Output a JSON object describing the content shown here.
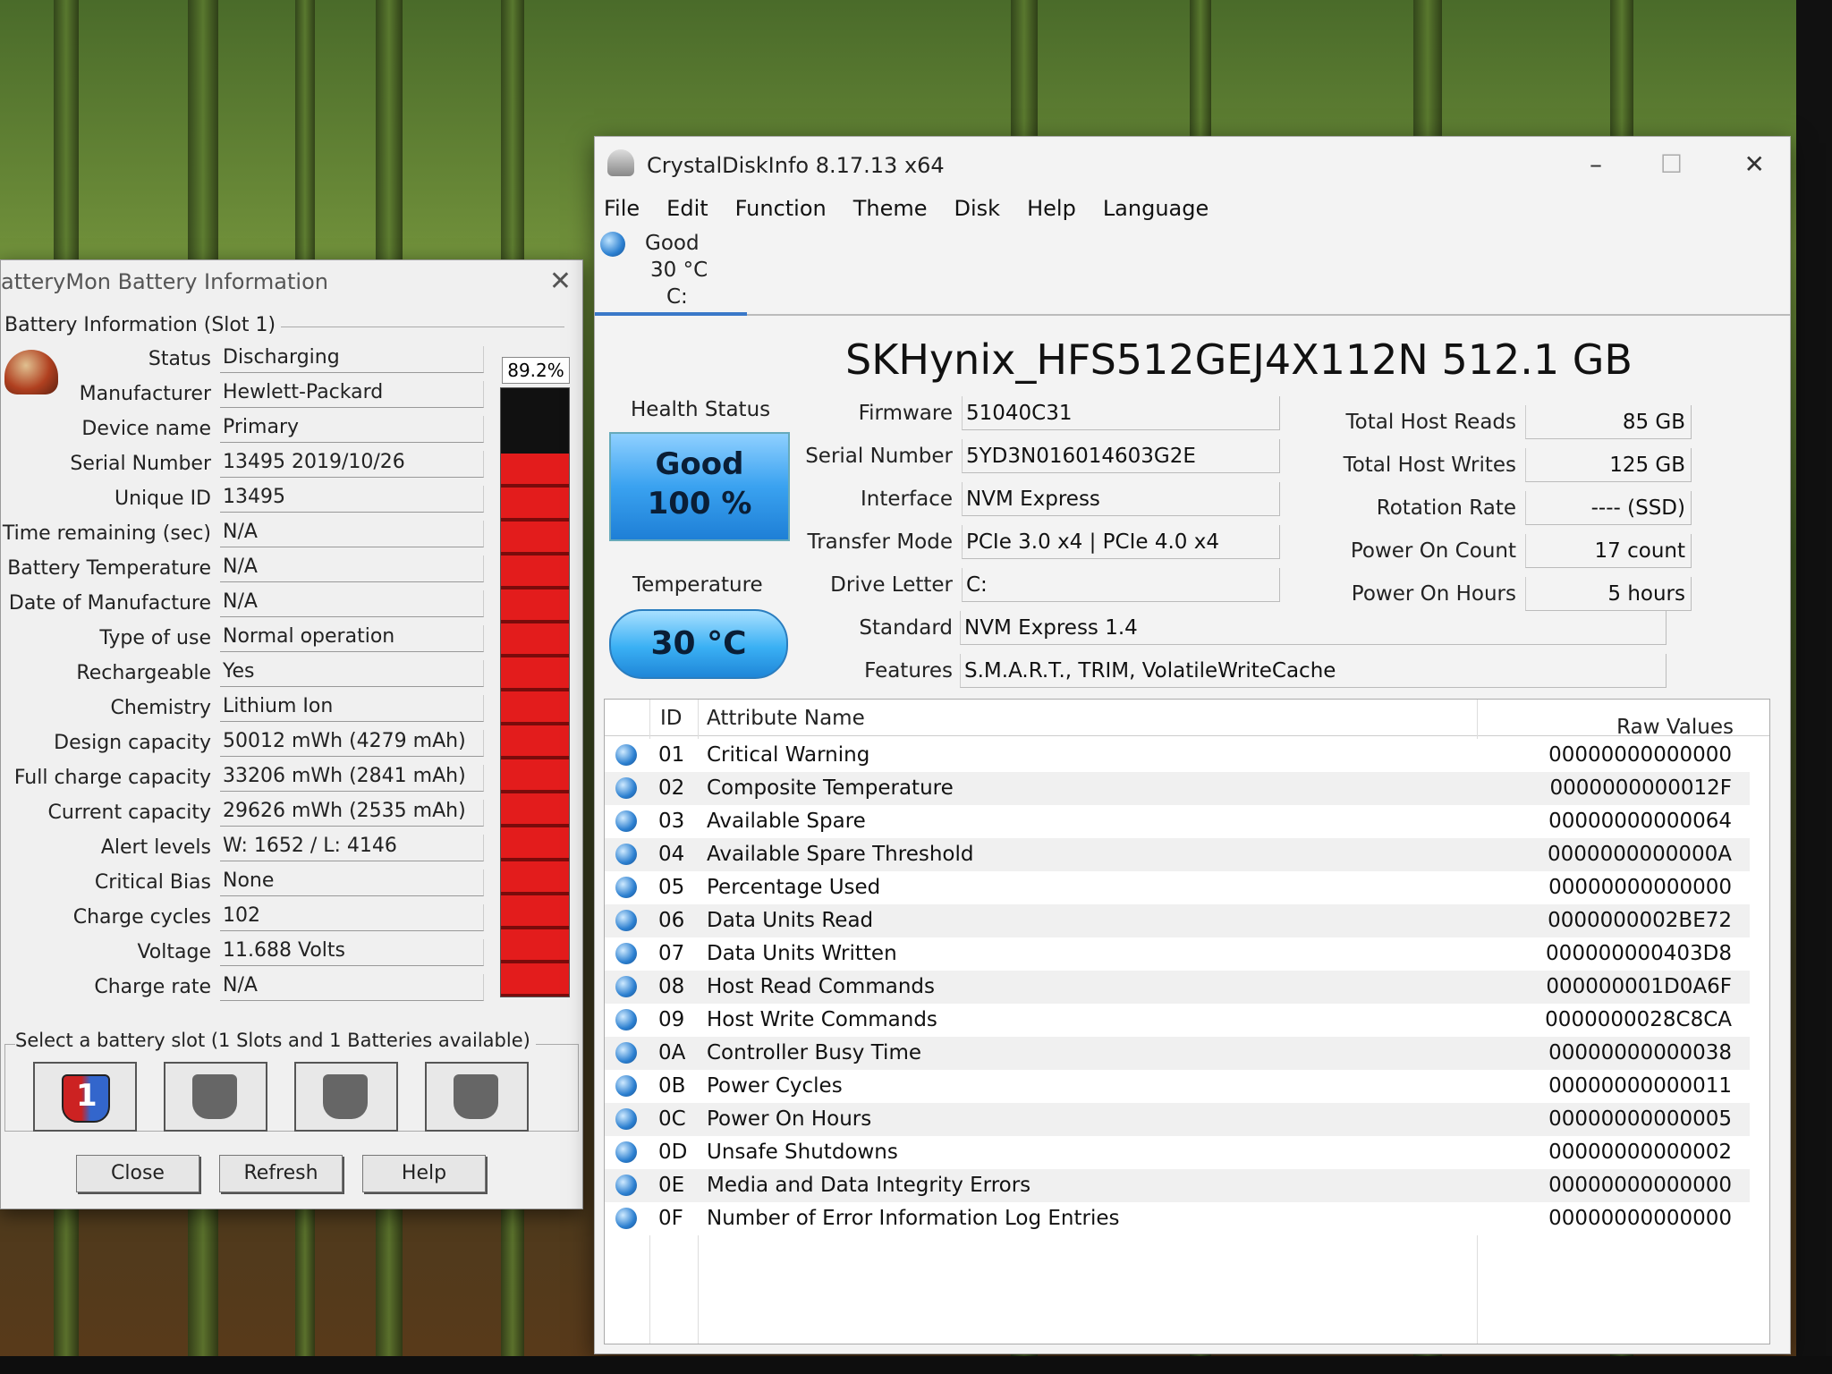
{
  "batterymon": {
    "title": "atteryMon Battery Information",
    "group_label": "Battery Information (Slot 1)",
    "percent": "89.2%",
    "charge_level_pct": 89.2,
    "fields": [
      {
        "label": "Status",
        "value": "Discharging"
      },
      {
        "label": "Manufacturer",
        "value": "Hewlett-Packard"
      },
      {
        "label": "Device name",
        "value": "Primary"
      },
      {
        "label": "Serial Number",
        "value": "13495 2019/10/26"
      },
      {
        "label": "Unique ID",
        "value": "13495"
      },
      {
        "label": "Time remaining (sec)",
        "value": "N/A"
      },
      {
        "label": "Battery Temperature",
        "value": "N/A"
      },
      {
        "label": "Date of Manufacture",
        "value": "N/A"
      },
      {
        "label": "Type of use",
        "value": "Normal operation"
      },
      {
        "label": "Rechargeable",
        "value": "Yes"
      },
      {
        "label": "Chemistry",
        "value": "Lithium Ion"
      },
      {
        "label": "Design capacity",
        "value": "50012 mWh (4279 mAh)"
      },
      {
        "label": "Full charge capacity",
        "value": "33206 mWh (2841 mAh)"
      },
      {
        "label": "Current capacity",
        "value": "29626 mWh (2535 mAh)"
      },
      {
        "label": "Alert levels",
        "value": "W: 1652 / L: 4146"
      },
      {
        "label": "Critical Bias",
        "value": "None"
      },
      {
        "label": "Charge cycles",
        "value": "102"
      },
      {
        "label": "Voltage",
        "value": "11.688 Volts"
      },
      {
        "label": "Charge rate",
        "value": "N/A"
      }
    ],
    "slot_label": "Select a battery slot (1 Slots and 1 Batteries available)",
    "slot1_number": "1",
    "buttons": {
      "close": "Close",
      "refresh": "Refresh",
      "help": "Help"
    }
  },
  "cdi": {
    "title": "CrystalDiskInfo 8.17.13 x64",
    "window_controls": {
      "minimize": "–",
      "maximize": "☐",
      "close": "✕"
    },
    "menu": [
      "File",
      "Edit",
      "Function",
      "Theme",
      "Disk",
      "Help",
      "Language"
    ],
    "disk_tab": {
      "health": "Good",
      "temp": "30 °C",
      "letter": "C:"
    },
    "disk_name": "SKHynix_HFS512GEJ4X112N 512.1 GB",
    "health_status_label": "Health Status",
    "health_status": "Good",
    "health_pct": "100 %",
    "temperature_label": "Temperature",
    "temperature": "30 °C",
    "info_mid": [
      {
        "label": "Firmware",
        "value": "51040C31"
      },
      {
        "label": "Serial Number",
        "value": "5YD3N016014603G2E"
      },
      {
        "label": "Interface",
        "value": "NVM Express"
      },
      {
        "label": "Transfer Mode",
        "value": "PCIe 3.0 x4 | PCIe 4.0 x4"
      },
      {
        "label": "Drive Letter",
        "value": "C:"
      }
    ],
    "info_right": [
      {
        "label": "Total Host Reads",
        "value": "85 GB"
      },
      {
        "label": "Total Host Writes",
        "value": "125 GB"
      },
      {
        "label": "Rotation Rate",
        "value": "---- (SSD)"
      },
      {
        "label": "Power On Count",
        "value": "17 count"
      },
      {
        "label": "Power On Hours",
        "value": "5 hours"
      }
    ],
    "standard_label": "Standard",
    "standard": "NVM Express 1.4",
    "features_label": "Features",
    "features": "S.M.A.R.T., TRIM, VolatileWriteCache",
    "smart_headers": {
      "id": "ID",
      "name": "Attribute Name",
      "raw": "Raw Values"
    },
    "smart": [
      {
        "id": "01",
        "name": "Critical Warning",
        "raw": "00000000000000"
      },
      {
        "id": "02",
        "name": "Composite Temperature",
        "raw": "0000000000012F"
      },
      {
        "id": "03",
        "name": "Available Spare",
        "raw": "00000000000064"
      },
      {
        "id": "04",
        "name": "Available Spare Threshold",
        "raw": "0000000000000A"
      },
      {
        "id": "05",
        "name": "Percentage Used",
        "raw": "00000000000000"
      },
      {
        "id": "06",
        "name": "Data Units Read",
        "raw": "0000000002BE72"
      },
      {
        "id": "07",
        "name": "Data Units Written",
        "raw": "000000000403D8"
      },
      {
        "id": "08",
        "name": "Host Read Commands",
        "raw": "000000001D0A6F"
      },
      {
        "id": "09",
        "name": "Host Write Commands",
        "raw": "0000000028C8CA"
      },
      {
        "id": "0A",
        "name": "Controller Busy Time",
        "raw": "00000000000038"
      },
      {
        "id": "0B",
        "name": "Power Cycles",
        "raw": "00000000000011"
      },
      {
        "id": "0C",
        "name": "Power On Hours",
        "raw": "00000000000005"
      },
      {
        "id": "0D",
        "name": "Unsafe Shutdowns",
        "raw": "00000000000002"
      },
      {
        "id": "0E",
        "name": "Media and Data Integrity Errors",
        "raw": "00000000000000"
      },
      {
        "id": "0F",
        "name": "Number of Error Information Log Entries",
        "raw": "00000000000000"
      }
    ]
  }
}
